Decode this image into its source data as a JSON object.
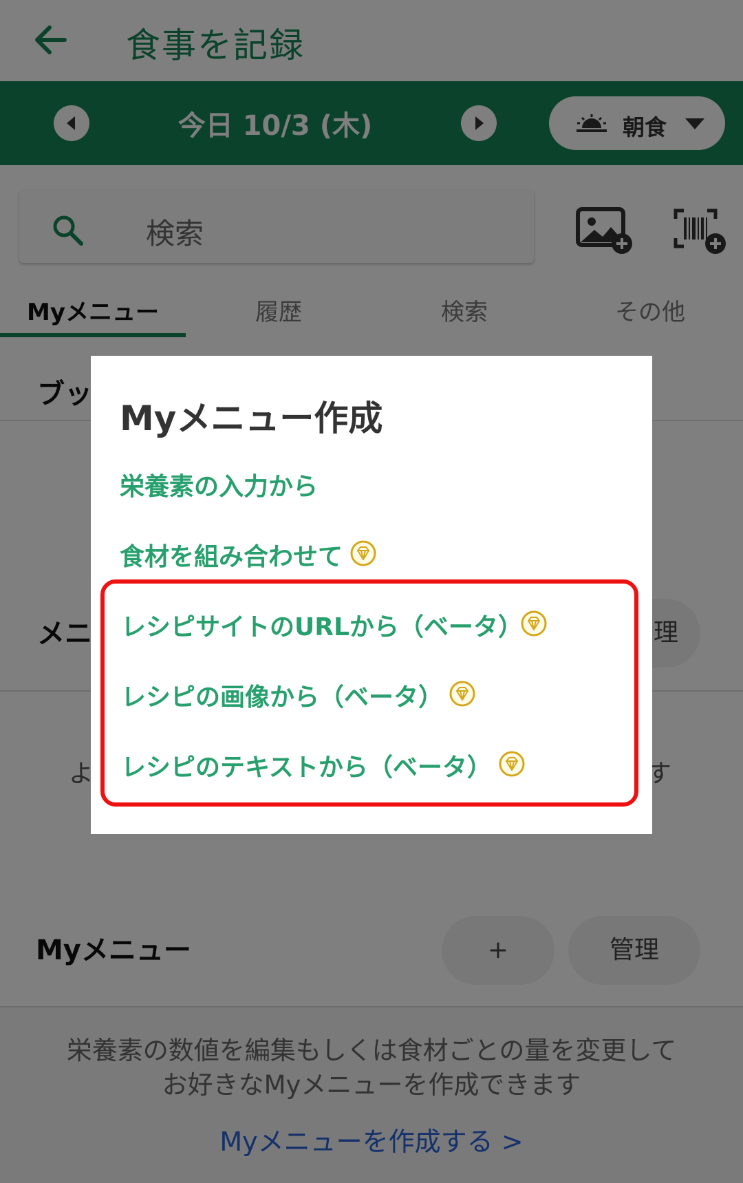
{
  "header": {
    "title": "食事を記録"
  },
  "date_bar": {
    "date": "今日 10/3 (木)",
    "meal": "朝食"
  },
  "search": {
    "placeholder": "検索"
  },
  "tabs": [
    {
      "label": "Myメニュー",
      "active": true
    },
    {
      "label": "履歴"
    },
    {
      "label": "検索"
    },
    {
      "label": "その他"
    }
  ],
  "background": {
    "section1_title": "ブッ",
    "section2_title": "メニ",
    "section2_button_partial": "理",
    "partial_left": "よ",
    "partial_right": "す",
    "my_menu_title": "Myメニュー",
    "add_label": "+",
    "manage_label": "管理",
    "empty_line1": "栄養素の数値を編集もしくは食材ごとの量を変更して",
    "empty_line2": "お好きなMyメニューを作成できます",
    "create_link": "Myメニューを作成する >"
  },
  "dialog": {
    "title": "Myメニュー作成",
    "options": [
      {
        "label": "栄養素の入力から",
        "premium": false
      },
      {
        "label": "食材を組み合わせて",
        "premium": true
      },
      {
        "label": "レシピサイトのURLから（ベータ）",
        "premium": true
      },
      {
        "label": "レシピの画像から（ベータ）",
        "premium": true
      },
      {
        "label": "レシピのテキストから（ベータ）",
        "premium": true
      }
    ]
  },
  "colors": {
    "brand_green": "#168557",
    "option_green": "#28a06e",
    "premium_gold": "#d4a81a",
    "highlight_red": "#ee1111",
    "link_blue": "#2a62d6"
  }
}
